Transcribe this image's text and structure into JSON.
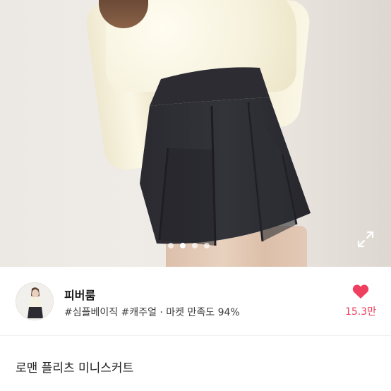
{
  "product_image": {
    "alt": "",
    "page_indicator": {
      "total": 4,
      "active": 2
    }
  },
  "icons": {
    "expand": "expand-arrows-icon",
    "like": "heart-icon"
  },
  "seller": {
    "name": "피버룸",
    "tags": "#심플베이직 #캐주얼 · 마켓 만족도 94%"
  },
  "like": {
    "count": "15.3만",
    "color": "#ee3f5f"
  },
  "product": {
    "title": "로맨 플리츠 미니스커트"
  }
}
